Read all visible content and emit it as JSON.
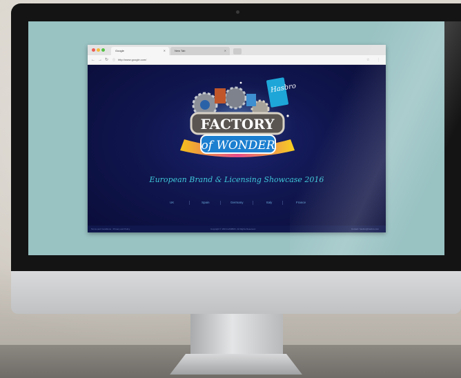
{
  "browser": {
    "tabs": [
      {
        "label": "Google",
        "active": true
      },
      {
        "label": "New Tab",
        "active": false
      }
    ],
    "address": "http://www.google.com/",
    "colors": {
      "red": "#ee5e55",
      "yellow": "#f3bb3a",
      "green": "#56c145"
    }
  },
  "page": {
    "logo": {
      "brand": "Hasbro",
      "line1": "FACTORY",
      "line2": "of WONDER"
    },
    "tagline": "European Brand & Licensing Showcase 2016",
    "countries": [
      "UK",
      "Spain",
      "Germany",
      "Italy",
      "France"
    ],
    "footer": {
      "left": "Terms and Conditions · Privacy and Policy",
      "center": "Copyright © 2016 HASBRO. All Rights Reserved.",
      "right": "Contact: hasbro@hasbro.com"
    }
  },
  "colors": {
    "screen_bg": "#99c2c3",
    "page_bg": "#10164f",
    "accent": "#3fc6d8"
  }
}
